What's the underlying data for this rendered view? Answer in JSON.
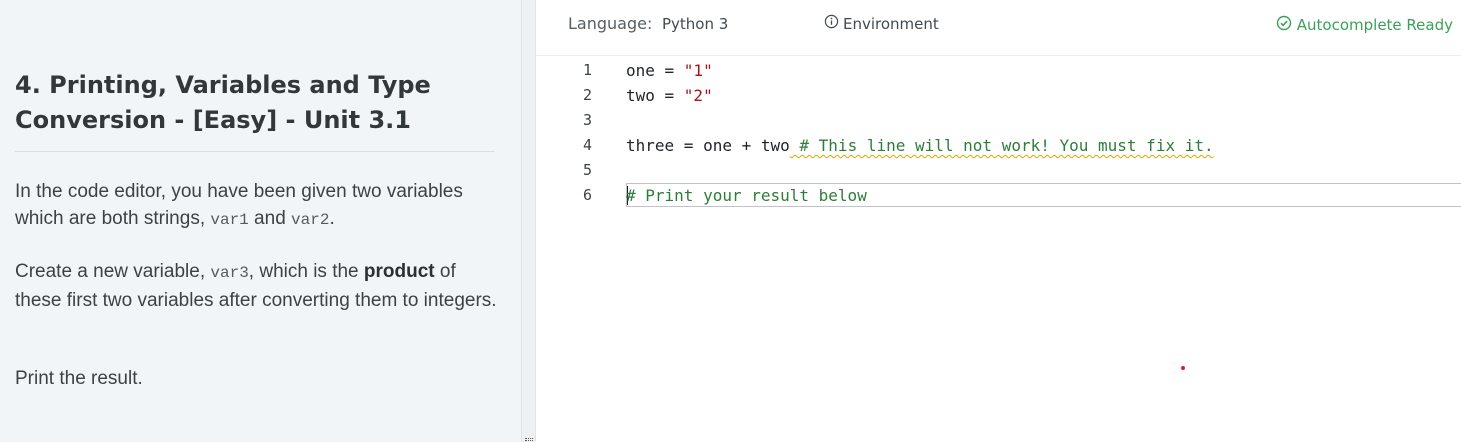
{
  "problem": {
    "title": "4. Printing, Variables and Type Conversion - [Easy] - Unit 3.1",
    "p1_text1": "In the code editor, you have been given two variables which are both strings, ",
    "p1_code1": "var1",
    "p1_text2": " and ",
    "p1_code2": "var2",
    "p1_text3": ".",
    "p2_text1": "Create a new variable, ",
    "p2_code1": "var3",
    "p2_text2": ", which is the ",
    "p2_bold": "product",
    "p2_text3": " of these first two variables after converting them to integers.",
    "p3": "Print the result."
  },
  "editor_header": {
    "language_label": "Language:",
    "language_value": "Python 3",
    "environment_label": "Environment",
    "autocomplete_status": "Autocomplete Ready",
    "status_color": "#3aa157",
    "icons": [
      "info-icon",
      "check-circle-icon"
    ]
  },
  "editor": {
    "line_numbers": [
      "1",
      "2",
      "3",
      "4",
      "5",
      "6"
    ],
    "lines": [
      {
        "code": "one = ",
        "string": "\"1\""
      },
      {
        "code": "two = ",
        "string": "\"2\""
      },
      {
        "code": ""
      },
      {
        "code": "three = one + two",
        "comment": " # This line will not work! You must fix it."
      },
      {
        "code": ""
      },
      {
        "comment": "# Print your result below"
      }
    ],
    "active_line": 6,
    "colors": {
      "string": "#a31515",
      "comment": "#2f7d3a",
      "warning_squiggle": "#d7a700"
    }
  }
}
